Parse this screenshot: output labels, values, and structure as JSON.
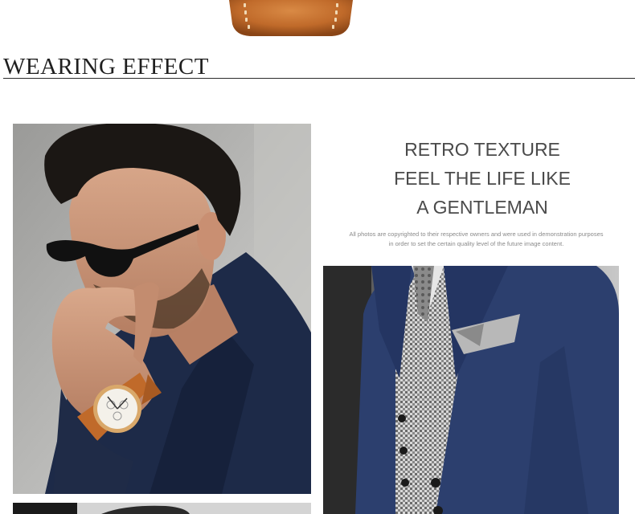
{
  "section": {
    "title": "WEARING EFFECT"
  },
  "headline": {
    "lines": [
      "RETRO TEXTURE",
      "FEEL THE LIFE LIKE",
      "A GENTLEMAN"
    ]
  },
  "disclaimer": {
    "lines": [
      "All photos are copyrighted to their respective owners and were used in  demonstration purposes",
      "in order to set the certain quality level of the future  image content."
    ]
  },
  "colors": {
    "strap_leather": "#c06a2a",
    "jacket_navy": "#1d2a48",
    "suit_blue": "#2c3f6e",
    "title_text": "#1f1f1f",
    "headline_text": "#4a4a4a"
  },
  "images": {
    "strap": "leather-watch-strap",
    "man": "man-with-sunglasses-wearing-watch",
    "suit": "navy-suit-with-pocket-square",
    "third": "partial-photo"
  }
}
